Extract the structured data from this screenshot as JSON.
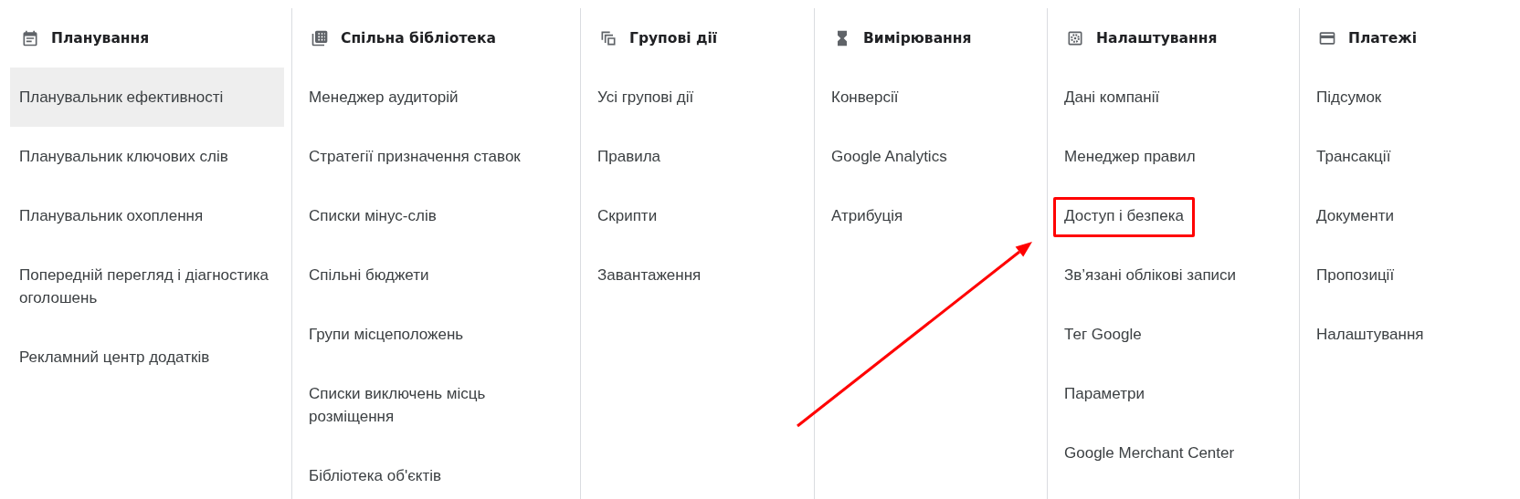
{
  "columns": [
    {
      "title": "Планування",
      "items": [
        {
          "label": "Планувальник ефективності",
          "selected": true,
          "outlined": false
        },
        {
          "label": "Планувальник ключових слів",
          "selected": false,
          "outlined": false
        },
        {
          "label": "Планувальник охоплення",
          "selected": false,
          "outlined": false
        },
        {
          "label": "Попередній перегляд і діагностика оголошень",
          "selected": false,
          "outlined": false
        },
        {
          "label": "Рекламний центр додатків",
          "selected": false,
          "outlined": false
        }
      ]
    },
    {
      "title": "Спільна бібліотека",
      "items": [
        {
          "label": "Менеджер аудиторій",
          "selected": false,
          "outlined": false
        },
        {
          "label": "Стратегії призначення ставок",
          "selected": false,
          "outlined": false
        },
        {
          "label": "Списки мінус-слів",
          "selected": false,
          "outlined": false
        },
        {
          "label": "Спільні бюджети",
          "selected": false,
          "outlined": false
        },
        {
          "label": "Групи місцеположень",
          "selected": false,
          "outlined": false
        },
        {
          "label": "Списки виключень місць розміщення",
          "selected": false,
          "outlined": false
        },
        {
          "label": "Бібліотека об'єктів",
          "selected": false,
          "outlined": false
        }
      ]
    },
    {
      "title": "Групові дії",
      "items": [
        {
          "label": "Усі групові дії",
          "selected": false,
          "outlined": false
        },
        {
          "label": "Правила",
          "selected": false,
          "outlined": false
        },
        {
          "label": "Скрипти",
          "selected": false,
          "outlined": false
        },
        {
          "label": "Завантаження",
          "selected": false,
          "outlined": false
        }
      ]
    },
    {
      "title": "Вимірювання",
      "items": [
        {
          "label": "Конверсії",
          "selected": false,
          "outlined": false
        },
        {
          "label": "Google Analytics",
          "selected": false,
          "outlined": false
        },
        {
          "label": "Атрибуція",
          "selected": false,
          "outlined": false
        }
      ]
    },
    {
      "title": "Налаштування",
      "items": [
        {
          "label": "Дані компанії",
          "selected": false,
          "outlined": false
        },
        {
          "label": "Менеджер правил",
          "selected": false,
          "outlined": false
        },
        {
          "label": "Доступ і безпека",
          "selected": false,
          "outlined": true
        },
        {
          "label": "Зв’язані облікові записи",
          "selected": false,
          "outlined": false
        },
        {
          "label": "Тег Google",
          "selected": false,
          "outlined": false
        },
        {
          "label": "Параметри",
          "selected": false,
          "outlined": false
        },
        {
          "label": "Google Merchant Center",
          "selected": false,
          "outlined": false
        }
      ]
    },
    {
      "title": "Платежі",
      "items": [
        {
          "label": "Підсумок",
          "selected": false,
          "outlined": false
        },
        {
          "label": "Трансакції",
          "selected": false,
          "outlined": false
        },
        {
          "label": "Документи",
          "selected": false,
          "outlined": false
        },
        {
          "label": "Пропозиції",
          "selected": false,
          "outlined": false
        },
        {
          "label": "Налаштування",
          "selected": false,
          "outlined": false
        }
      ]
    }
  ],
  "annotations": [
    {
      "kind": "arrow"
    }
  ]
}
